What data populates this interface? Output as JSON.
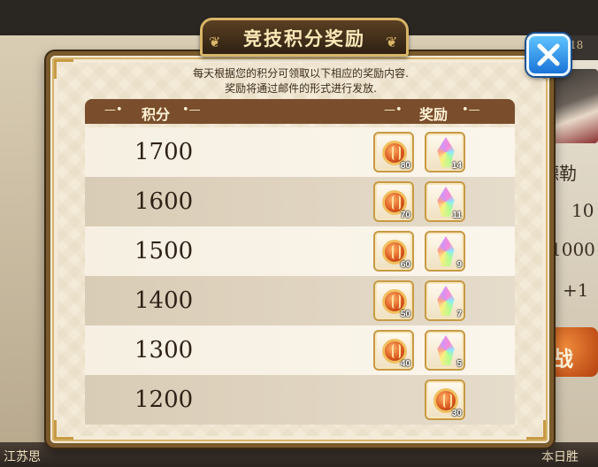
{
  "modal": {
    "title": "竞技积分奖励",
    "description_line1": "每天根据您的积分可领取以下相应的奖励内容.",
    "description_line2": "奖励将通过邮件的形式进行发放.",
    "header_points": "积分",
    "header_rewards": "奖励",
    "close_label": "X"
  },
  "rows": [
    {
      "points": "1700",
      "rewards": [
        {
          "icon": "coin-icon",
          "qty": "80"
        },
        {
          "icon": "crystal-icon",
          "qty": "14"
        }
      ]
    },
    {
      "points": "1600",
      "rewards": [
        {
          "icon": "coin-icon",
          "qty": "70"
        },
        {
          "icon": "crystal-icon",
          "qty": "11"
        }
      ]
    },
    {
      "points": "1500",
      "rewards": [
        {
          "icon": "coin-icon",
          "qty": "60"
        },
        {
          "icon": "crystal-icon",
          "qty": "9"
        }
      ]
    },
    {
      "points": "1400",
      "rewards": [
        {
          "icon": "coin-icon",
          "qty": "50"
        },
        {
          "icon": "crystal-icon",
          "qty": "7"
        }
      ]
    },
    {
      "points": "1300",
      "rewards": [
        {
          "icon": "coin-icon",
          "qty": "40"
        },
        {
          "icon": "crystal-icon",
          "qty": "5"
        }
      ]
    },
    {
      "points": "1200",
      "rewards": [
        {
          "icon": "coin-icon",
          "qty": "30"
        }
      ]
    }
  ],
  "background": {
    "header_text": "18",
    "name_text": "德勒",
    "value1": "10",
    "value2": "1000",
    "value3": "+1",
    "button_text": "战",
    "bottom_left_text": "江苏思",
    "bottom_right_text": "本日胜"
  },
  "colors": {
    "header_bg": "#7a4e2c",
    "frame": "#7a5a2c",
    "close_button": "#1a74d8"
  }
}
